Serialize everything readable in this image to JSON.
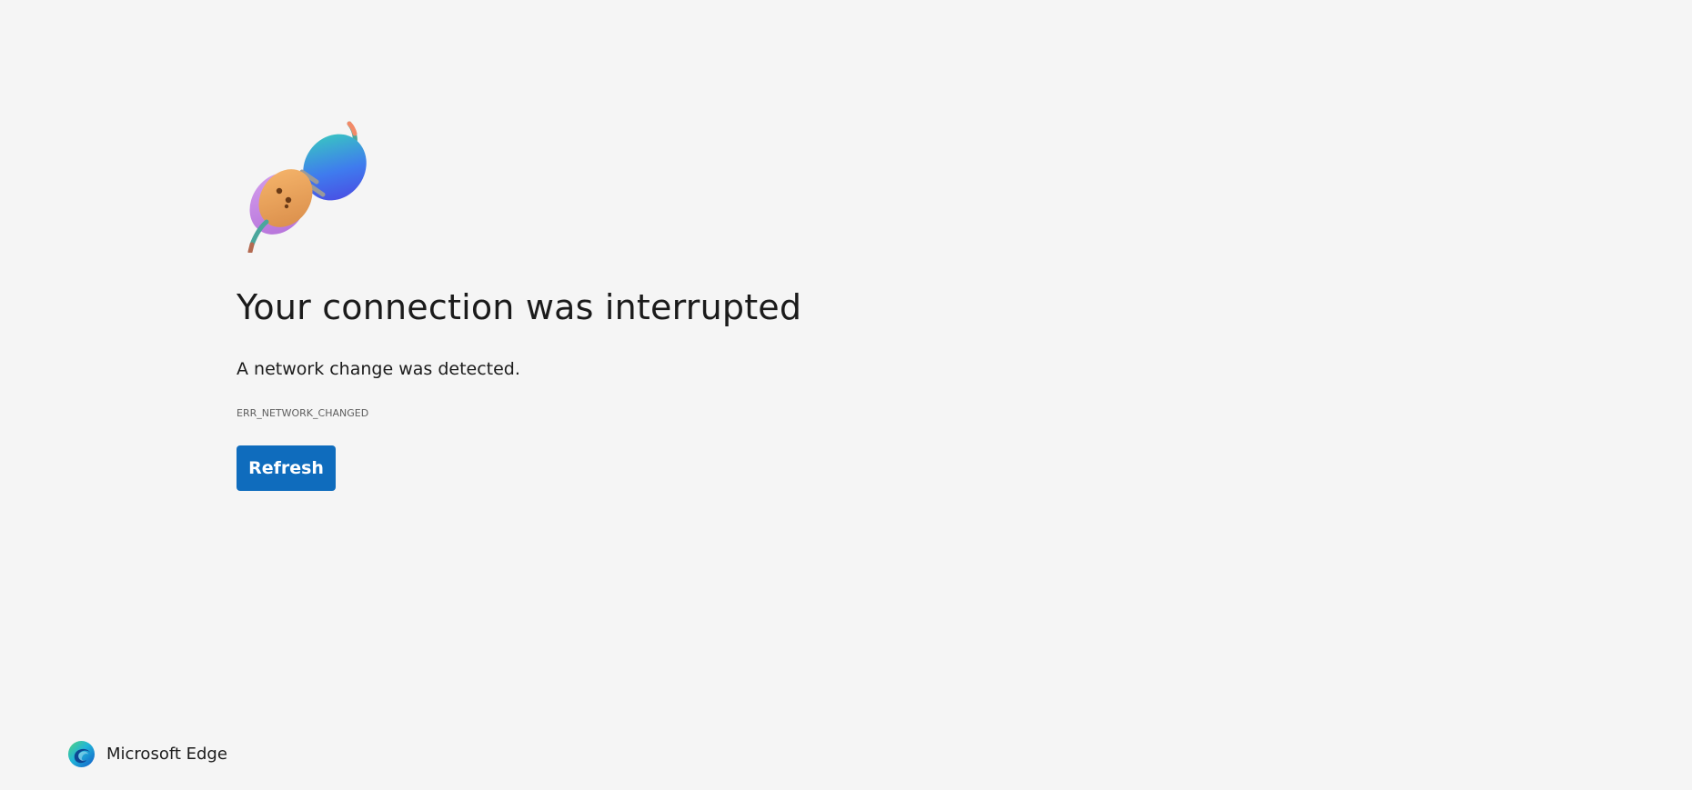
{
  "error_page": {
    "title": "Your connection was interrupted",
    "message": "A network change was detected.",
    "error_code": "ERR_NETWORK_CHANGED",
    "refresh_label": "Refresh"
  },
  "footer": {
    "brand_name": "Microsoft Edge"
  },
  "icons": {
    "illustration": "unplugged-plug-illustration",
    "logo": "microsoft-edge-logo-icon"
  },
  "colors": {
    "background": "#f5f5f5",
    "button": "#0f6cbd",
    "text": "#1b1b1b",
    "muted_text": "#5e5e5e"
  }
}
